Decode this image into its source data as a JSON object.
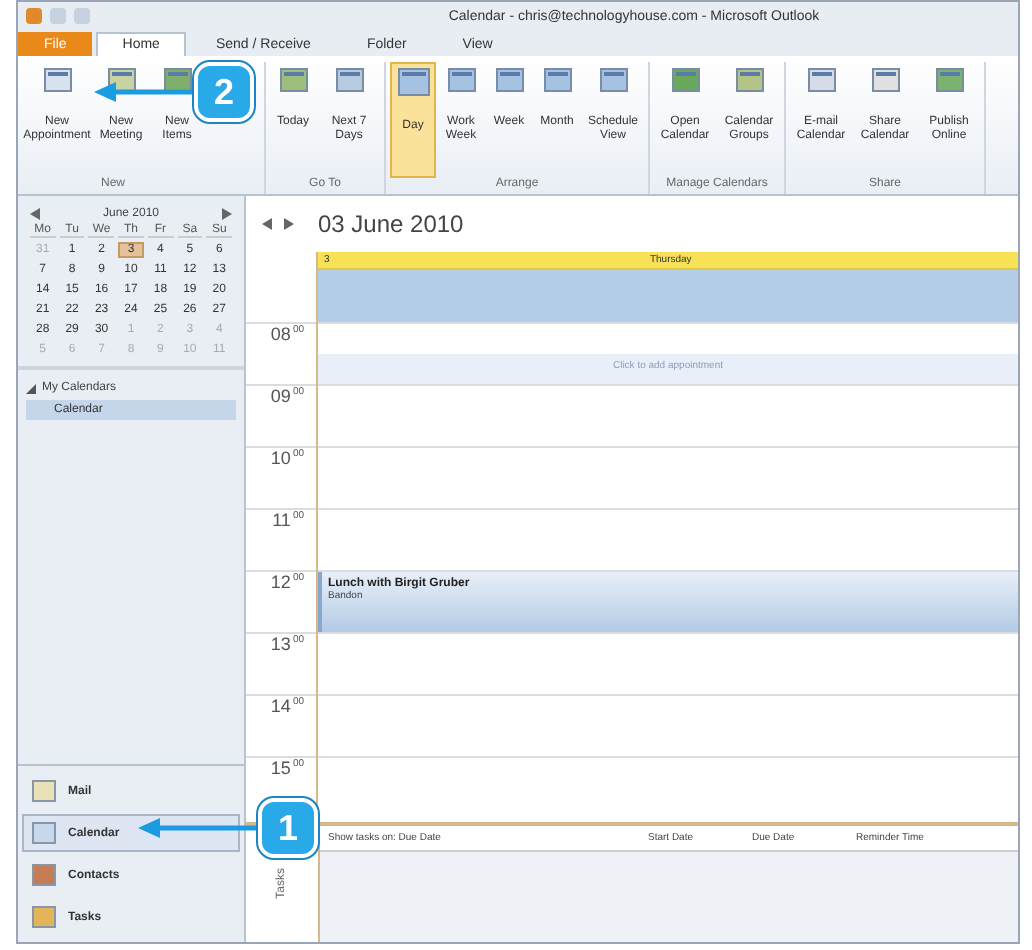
{
  "window": {
    "title": "Calendar - chris@technologyhouse.com - Microsoft Outlook"
  },
  "tabs": [
    {
      "label": "File",
      "selected": false,
      "kind": "file"
    },
    {
      "label": "Home",
      "selected": true,
      "kind": "tab"
    },
    {
      "label": "Send / Receive",
      "selected": false,
      "kind": "tab"
    },
    {
      "label": "Folder",
      "selected": false,
      "kind": "tab"
    },
    {
      "label": "View",
      "selected": false,
      "kind": "tab"
    }
  ],
  "ribbon": {
    "groups": [
      {
        "label": "New",
        "buttons": [
          {
            "label": "New Appointment",
            "selected": false
          },
          {
            "label": "New Meeting",
            "selected": false
          },
          {
            "label": "New Items",
            "selected": false
          }
        ]
      },
      {
        "label": "Go To",
        "buttons": [
          {
            "label": "Today",
            "selected": false
          },
          {
            "label": "Next 7 Days",
            "selected": false
          }
        ]
      },
      {
        "label": "Arrange",
        "buttons": [
          {
            "label": "Day",
            "selected": true
          },
          {
            "label": "Work Week",
            "selected": false
          },
          {
            "label": "Week",
            "selected": false
          },
          {
            "label": "Month",
            "selected": false
          },
          {
            "label": "Schedule View",
            "selected": false
          }
        ]
      },
      {
        "label": "Manage Calendars",
        "buttons": [
          {
            "label": "Open Calendar",
            "selected": false
          },
          {
            "label": "Calendar Groups",
            "selected": false
          }
        ]
      },
      {
        "label": "Share",
        "buttons": [
          {
            "label": "E-mail Calendar",
            "selected": false
          },
          {
            "label": "Share Calendar",
            "selected": false
          },
          {
            "label": "Publish Online",
            "selected": false
          }
        ]
      }
    ]
  },
  "mini_calendar": {
    "month": "June 2010",
    "weekdays": [
      "Mo",
      "Tu",
      "We",
      "Th",
      "Fr",
      "Sa",
      "Su"
    ],
    "days": [
      {
        "label": "31",
        "selected": false,
        "other_month": true
      },
      {
        "label": "1",
        "selected": false,
        "other_month": false
      },
      {
        "label": "2",
        "selected": false,
        "other_month": false
      },
      {
        "label": "3",
        "selected": true,
        "other_month": false
      },
      {
        "label": "4",
        "selected": false,
        "other_month": false
      },
      {
        "label": "5",
        "selected": false,
        "other_month": false
      },
      {
        "label": "6",
        "selected": false,
        "other_month": false
      },
      {
        "label": "7",
        "selected": false,
        "other_month": false
      },
      {
        "label": "8",
        "selected": false,
        "other_month": false
      },
      {
        "label": "9",
        "selected": false,
        "other_month": false
      },
      {
        "label": "10",
        "selected": false,
        "other_month": false
      },
      {
        "label": "11",
        "selected": false,
        "other_month": false
      },
      {
        "label": "12",
        "selected": false,
        "other_month": false
      },
      {
        "label": "13",
        "selected": false,
        "other_month": false
      },
      {
        "label": "14",
        "selected": false,
        "other_month": false
      },
      {
        "label": "15",
        "selected": false,
        "other_month": false
      },
      {
        "label": "16",
        "selected": false,
        "other_month": false
      },
      {
        "label": "17",
        "selected": false,
        "other_month": false
      },
      {
        "label": "18",
        "selected": false,
        "other_month": false
      },
      {
        "label": "19",
        "selected": false,
        "other_month": false
      },
      {
        "label": "20",
        "selected": false,
        "other_month": false
      },
      {
        "label": "21",
        "selected": false,
        "other_month": false
      },
      {
        "label": "22",
        "selected": false,
        "other_month": false
      },
      {
        "label": "23",
        "selected": false,
        "other_month": false
      },
      {
        "label": "24",
        "selected": false,
        "other_month": false
      },
      {
        "label": "25",
        "selected": false,
        "other_month": false
      },
      {
        "label": "26",
        "selected": false,
        "other_month": false
      },
      {
        "label": "27",
        "selected": false,
        "other_month": false
      },
      {
        "label": "28",
        "selected": false,
        "other_month": false
      },
      {
        "label": "29",
        "selected": false,
        "other_month": false
      },
      {
        "label": "30",
        "selected": false,
        "other_month": false
      },
      {
        "label": "1",
        "selected": false,
        "other_month": true
      },
      {
        "label": "2",
        "selected": false,
        "other_month": true
      },
      {
        "label": "3",
        "selected": false,
        "other_month": true
      },
      {
        "label": "4",
        "selected": false,
        "other_month": true
      },
      {
        "label": "5",
        "selected": false,
        "other_month": true
      },
      {
        "label": "6",
        "selected": false,
        "other_month": true
      },
      {
        "label": "7",
        "selected": false,
        "other_month": true
      },
      {
        "label": "8",
        "selected": false,
        "other_month": true
      },
      {
        "label": "9",
        "selected": false,
        "other_month": true
      },
      {
        "label": "10",
        "selected": false,
        "other_month": true
      },
      {
        "label": "11",
        "selected": false,
        "other_month": true
      }
    ]
  },
  "folders": {
    "group": "My Calendars",
    "expanded": true,
    "items": [
      {
        "label": "Calendar",
        "selected": true
      }
    ]
  },
  "navigation": [
    {
      "label": "Mail",
      "selected": false
    },
    {
      "label": "Calendar",
      "selected": true
    },
    {
      "label": "Contacts",
      "selected": false
    },
    {
      "label": "Tasks",
      "selected": false
    }
  ],
  "day_view": {
    "date": "03 June 2010",
    "day_number": "3",
    "day_name": "Thursday",
    "add_hint": "Click to add appointment",
    "hours": [
      {
        "hour": "08",
        "minutes": "00"
      },
      {
        "hour": "09",
        "minutes": "00"
      },
      {
        "hour": "10",
        "minutes": "00"
      },
      {
        "hour": "11",
        "minutes": "00"
      },
      {
        "hour": "12",
        "minutes": "00",
        "appointment": {
          "title": "Lunch with Birgit Gruber",
          "location": "Bandon"
        }
      },
      {
        "hour": "13",
        "minutes": "00"
      },
      {
        "hour": "14",
        "minutes": "00"
      },
      {
        "hour": "15",
        "minutes": "00"
      }
    ]
  },
  "tasks_pane": {
    "side_label": "Tasks",
    "columns": [
      "Show tasks on: Due Date",
      "Start Date",
      "Due Date",
      "Reminder Time"
    ]
  },
  "callouts": [
    "2",
    "1"
  ]
}
